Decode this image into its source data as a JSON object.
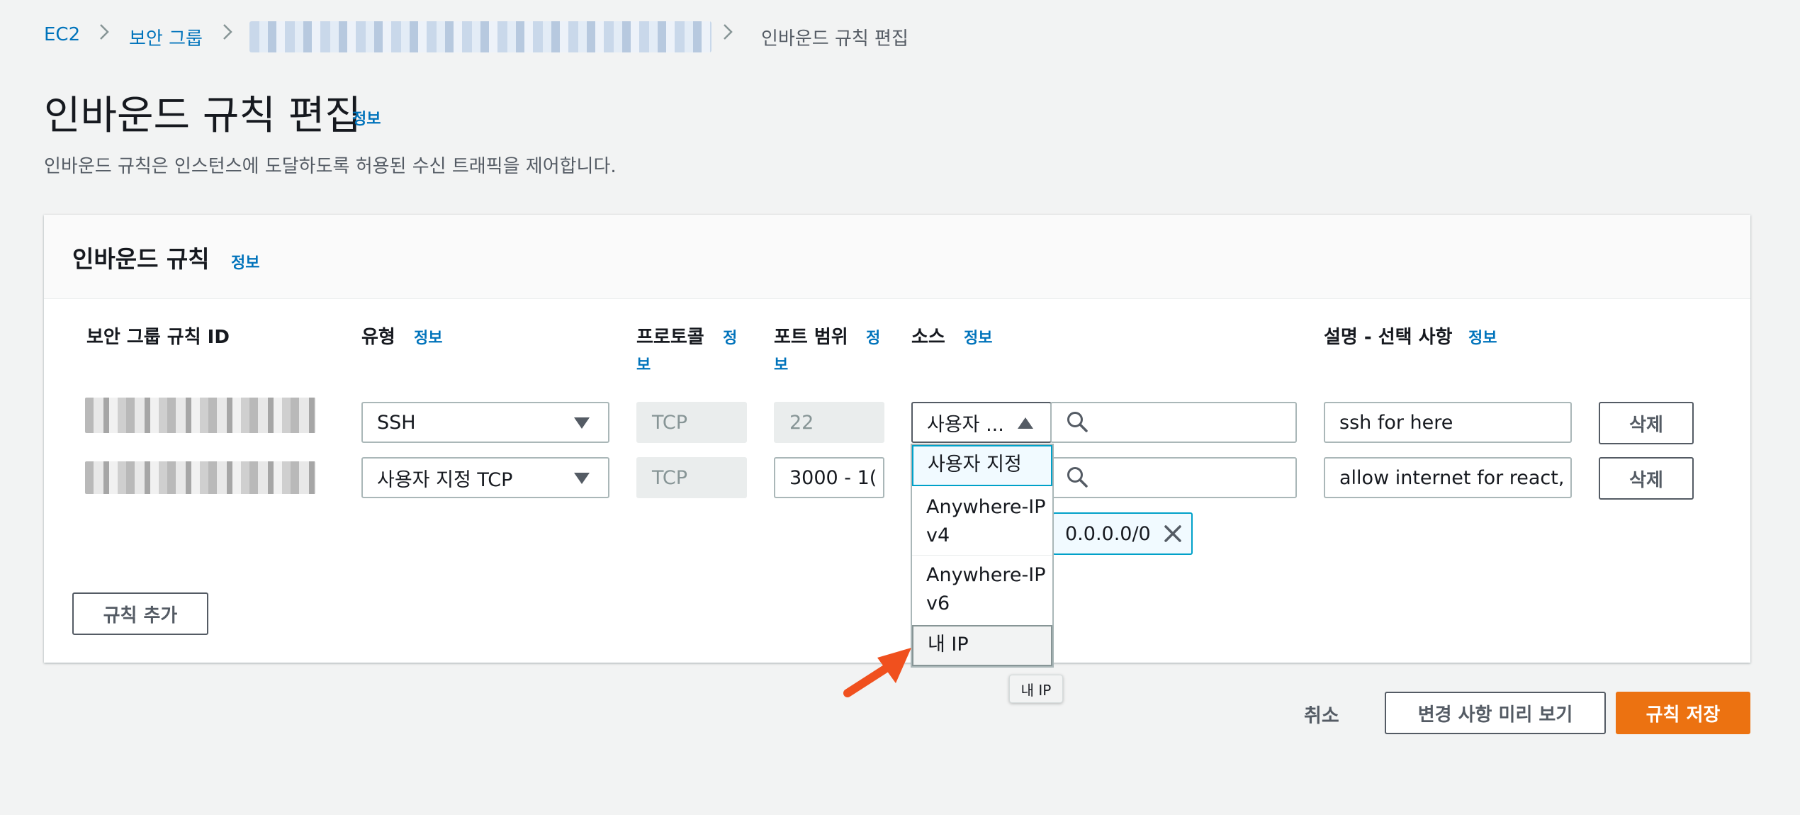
{
  "breadcrumb": {
    "ec2": "EC2",
    "security_groups": "보안 그룹",
    "current": "인바운드 규칙 편집"
  },
  "page": {
    "title": "인바운드 규칙 편집",
    "info": "정보",
    "description": "인바운드 규칙은 인스턴스에 도달하도록 허용된 수신 트래픽을 제어합니다."
  },
  "panel": {
    "title": "인바운드 규칙",
    "info": "정보"
  },
  "columns": {
    "rule_id": "보안 그룹 규칙 ID",
    "type": "유형",
    "protocol": "프로토콜",
    "port_range": "포트 범위",
    "source": "소스",
    "description": "설명 - 선택 사항",
    "info": "정보",
    "info_split_a": "정",
    "info_split_b": "보"
  },
  "rows": [
    {
      "type": "SSH",
      "protocol": "TCP",
      "port": "22",
      "source_select": "사용자 ...",
      "description": "ssh for here",
      "delete": "삭제"
    },
    {
      "type": "사용자 지정 TCP",
      "protocol": "TCP",
      "port": "3000 - 1(",
      "description": "allow internet for react,",
      "delete": "삭제",
      "cidr_chip": "0.0.0.0/0"
    }
  ],
  "source_dropdown": {
    "options": [
      "사용자 지정",
      "Anywhere-IPv4",
      "Anywhere-IPv6",
      "내 IP"
    ],
    "selected_index": 0,
    "hovered_index": 3
  },
  "tooltip": "내 IP",
  "buttons": {
    "add_rule": "규칙 추가",
    "cancel": "취소",
    "preview": "변경 사항 미리 보기",
    "save": "규칙 저장"
  },
  "colors": {
    "link": "#0073bb",
    "primary_button": "#ec7211",
    "annotation_arrow": "#f0501e"
  },
  "icons": [
    "chevron-right-icon",
    "caret-down-icon",
    "caret-up-icon",
    "search-icon",
    "close-icon",
    "arrow-annotation"
  ]
}
